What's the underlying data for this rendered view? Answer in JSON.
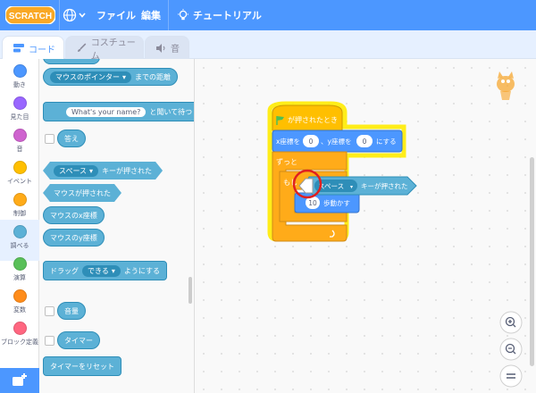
{
  "menubar": {
    "logo_text": "SCRATCH",
    "file_label": "ファイル",
    "edit_label": "編集",
    "tutorial_label": "チュートリアル"
  },
  "tabs": [
    {
      "label": "コード",
      "icon": "code-icon",
      "active": true
    },
    {
      "label": "コスチューム",
      "icon": "brush-icon",
      "active": false
    },
    {
      "label": "音",
      "icon": "speaker-icon",
      "active": false
    }
  ],
  "categories": [
    {
      "label": "動き",
      "color": "#4c97ff"
    },
    {
      "label": "見た目",
      "color": "#9966ff"
    },
    {
      "label": "音",
      "color": "#cf63cf"
    },
    {
      "label": "イベント",
      "color": "#ffbf00"
    },
    {
      "label": "制御",
      "color": "#ffab19"
    },
    {
      "label": "調べる",
      "color": "#5cb1d6",
      "selected": true
    },
    {
      "label": "演算",
      "color": "#59c059"
    },
    {
      "label": "変数",
      "color": "#ff8c1a"
    },
    {
      "label": "ブロック定義",
      "color": "#ff6680"
    }
  ],
  "flyout": {
    "distance_dropdown": "マウスのポインター",
    "distance_suffix": "までの距離",
    "ask_default": "What's your name?",
    "ask_suffix": "と聞いて待つ",
    "answer": "答え",
    "key_dropdown": "スペース",
    "key_suffix": "キーが押された",
    "mouse_down": "マウスが押された",
    "mouse_x": "マウスのx座標",
    "mouse_y": "マウスのy座標",
    "drag_prefix": "ドラッグ",
    "drag_dropdown": "できる",
    "drag_suffix": "ようにする",
    "loudness": "音量",
    "timer": "タイマー",
    "reset_timer": "タイマーをリセット"
  },
  "script": {
    "hat": "が押されたとき",
    "goto_x_label": "x座標を",
    "goto_x": "0",
    "goto_sep": "、y座標を",
    "goto_y": "0",
    "goto_suffix": "にする",
    "forever": "ずっと",
    "if_label": "もし",
    "move_value": "10",
    "move_suffix": "歩動かす",
    "drag_key_dropdown": "スペース",
    "drag_key_suffix": "キーが押された"
  },
  "zoom": {
    "in_icon": "zoom-in-icon",
    "out_icon": "zoom-out-icon",
    "reset_icon": "zoom-reset-icon"
  },
  "colors": {
    "menubar": "#4c97ff",
    "sensing": "#5cb1d6",
    "events": "#ffbf00",
    "control": "#ffab19",
    "motion": "#4c97ff",
    "highlight": "#ffeb00",
    "cursor_ring": "#e02020"
  }
}
